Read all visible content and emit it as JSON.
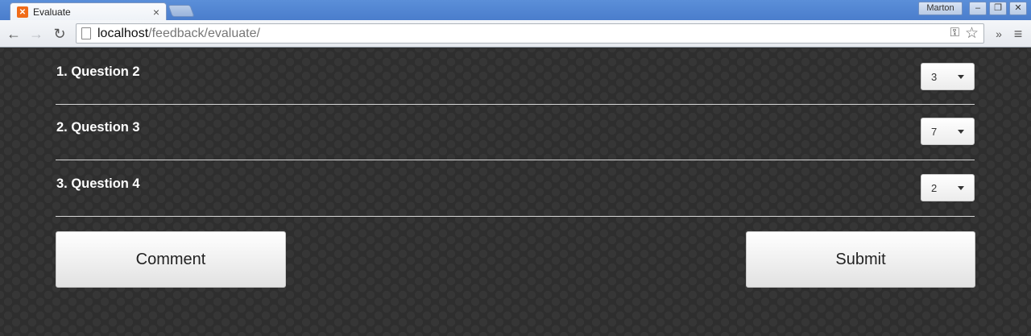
{
  "browser": {
    "tab_title": "Evaluate",
    "tab_close": "×",
    "profile_name": "Marton",
    "url_host": "localhost",
    "url_path": "/feedback/evaluate/",
    "icons": {
      "back": "back-arrow-icon",
      "forward": "forward-arrow-icon",
      "reload": "reload-icon",
      "key": "key-icon",
      "star": "star-icon",
      "more": "chevron-double-right-icon",
      "menu": "hamburger-menu-icon",
      "favicon": "xampp-favicon-icon"
    }
  },
  "questions": [
    {
      "label": "1. Question 2",
      "selected": "3"
    },
    {
      "label": "2. Question 3",
      "selected": "7"
    },
    {
      "label": "3. Question 4",
      "selected": "2"
    }
  ],
  "actions": {
    "comment_label": "Comment",
    "submit_label": "Submit"
  },
  "colors": {
    "page_background": "#2e2e2e",
    "titlebar": "#4a7dcc",
    "text_on_dark": "#ffffff"
  }
}
